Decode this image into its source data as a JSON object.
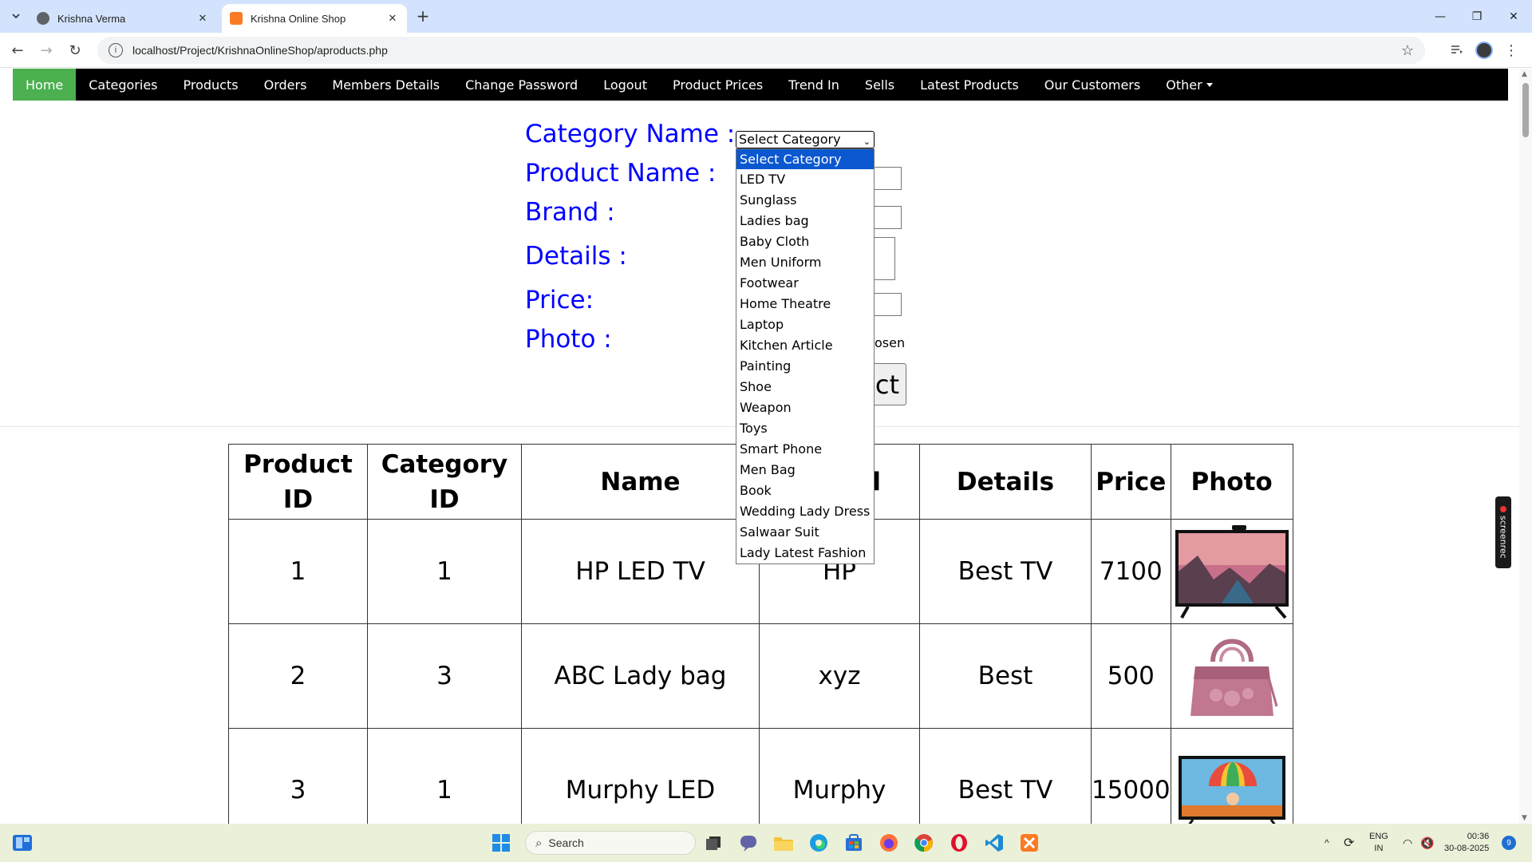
{
  "browser": {
    "tabs": [
      {
        "title": "Krishna Verma",
        "active": false
      },
      {
        "title": "Krishna Online Shop",
        "active": true
      }
    ],
    "url": "localhost/Project/KrishnaOnlineShop/aproducts.php"
  },
  "nav": {
    "items": [
      "Home",
      "Categories",
      "Products",
      "Orders",
      "Members Details",
      "Change Password",
      "Logout",
      "Product Prices",
      "Trend In",
      "Sells",
      "Latest Products",
      "Our Customers",
      "Other"
    ],
    "active": "Home"
  },
  "form": {
    "category_label": "Category Name :",
    "product_label": "Product Name :",
    "brand_label": "Brand :",
    "details_label": "Details :",
    "price_label": "Price:",
    "photo_label": "Photo :",
    "category_selected": "Select Category",
    "file_partial": "osen",
    "submit_partial": "ct"
  },
  "dropdown": {
    "options": [
      "Select Category",
      "LED TV",
      "Sunglass",
      "Ladies bag",
      "Baby Cloth",
      "Men Uniform",
      "Footwear",
      "Home Theatre",
      "Laptop",
      "Kitchen Article",
      "Painting",
      "Shoe",
      "Weapon",
      "Toys",
      "Smart Phone",
      "Men Bag",
      "Book",
      "Wedding Lady Dress",
      "Salwaar Suit",
      "Lady Latest Fashion"
    ]
  },
  "table": {
    "headers": {
      "product_id_1": "Product",
      "product_id_2": "ID",
      "category_id_1": "Category",
      "category_id_2": "ID",
      "name": "Name",
      "brand_partial": "l",
      "details": "Details",
      "price": "Price",
      "photo": "Photo"
    },
    "rows": [
      {
        "product_id": "1",
        "category_id": "1",
        "name": "HP LED TV",
        "brand": "HP",
        "details": "Best TV",
        "price": "7100",
        "photo_icon": "led-tv-image"
      },
      {
        "product_id": "2",
        "category_id": "3",
        "name": "ABC Lady bag",
        "brand": "xyz",
        "details": "Best",
        "price": "500",
        "photo_icon": "lady-bag-image"
      },
      {
        "product_id": "3",
        "category_id": "1",
        "name": "Murphy LED",
        "brand": "Murphy",
        "details": "Best TV",
        "price": "15000",
        "photo_icon": "led-tv-image"
      }
    ]
  },
  "taskbar": {
    "search_placeholder": "Search",
    "lang_top": "ENG",
    "lang_bottom": "IN",
    "time": "00:36",
    "date": "30-08-2025",
    "notifications": "9"
  },
  "overlay": {
    "screenrec": "screenrec"
  }
}
